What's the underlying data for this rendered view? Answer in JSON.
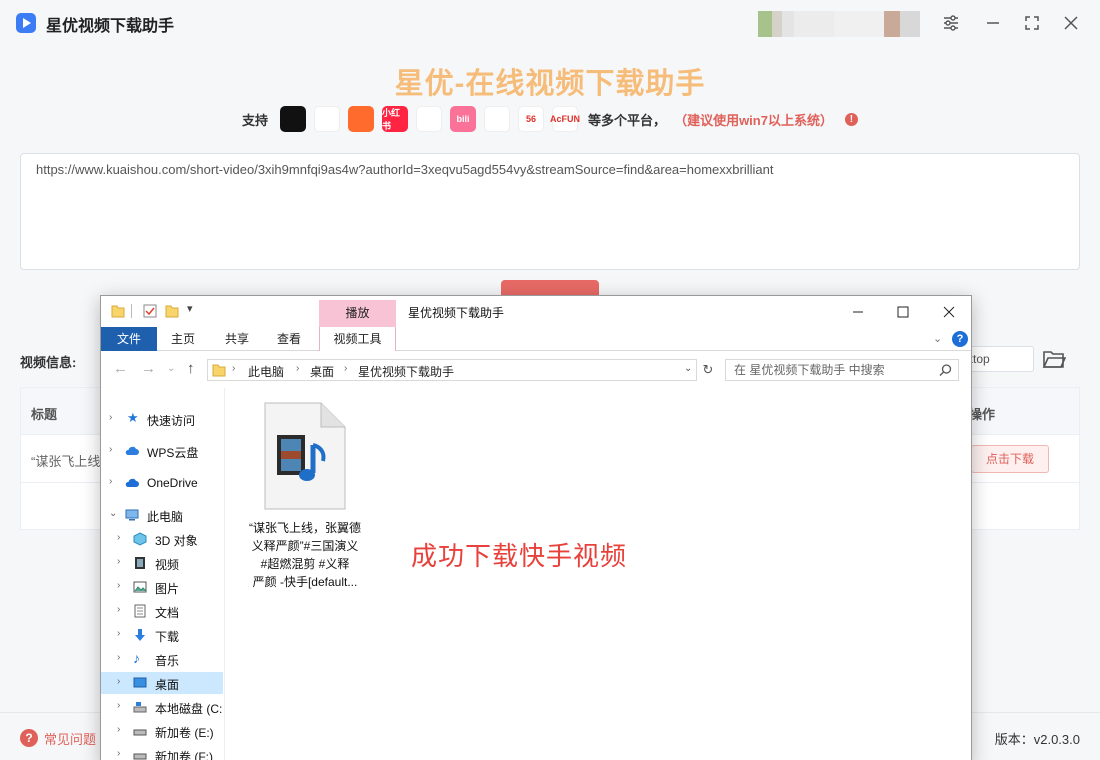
{
  "app": {
    "name": "星优视频下载助手",
    "hero_title": "星优-在线视频下载助手",
    "support_label": "支持",
    "platforms": [
      {
        "name": "douyin-icon",
        "text": "",
        "color": "#111111"
      },
      {
        "name": "weibo-icon",
        "text": "",
        "color": "#ffffff"
      },
      {
        "name": "kuaishou-icon",
        "text": "",
        "color": "#ff6b2c"
      },
      {
        "name": "xiaohongshu-icon",
        "text": "小红书",
        "color": "#ff2442"
      },
      {
        "name": "tencent-video-icon",
        "text": "",
        "color": "#ffffff"
      },
      {
        "name": "bilibili-icon",
        "text": "bili",
        "color": "#fb7299"
      },
      {
        "name": "cctv-icon",
        "text": "",
        "color": "#ffffff"
      },
      {
        "name": "56-icon",
        "text": "56",
        "color": "#ffffff"
      },
      {
        "name": "acfun-icon",
        "text": "AcFUN",
        "color": "#ffffff"
      }
    ],
    "platforms_more": "等多个平台，",
    "system_hint": "（建议使用win7以上系统）",
    "url_value": "https://www.kuaishou.com/short-video/3xih9mnfqi9as4w?authorId=3xeqvu5agd554vy&streamSource=find&area=homexxbrilliant",
    "video_info_label": "视频信息:",
    "save_path_value": "ktop",
    "table": {
      "headers": {
        "title": "标题",
        "action": "操作"
      },
      "row": {
        "title": "“谋张飞上线",
        "action": "点击下载"
      }
    },
    "footer": {
      "faq": "常见问题",
      "version": "版本：v2.0.3.0"
    }
  },
  "explorer": {
    "context_tab": "播放",
    "window_title": "星优视频下载助手",
    "ribbon_tabs": [
      "文件",
      "主页",
      "共享",
      "查看",
      "视频工具"
    ],
    "breadcrumb": [
      "此电脑",
      "桌面",
      "星优视频下载助手"
    ],
    "search_placeholder": "在 星优视频下载助手 中搜索",
    "nav": {
      "quick_access": "快速访问",
      "wps": "WPS云盘",
      "onedrive": "OneDrive",
      "this_pc": "此电脑",
      "objects3d": "3D 对象",
      "videos": "视频",
      "pictures": "图片",
      "documents": "文档",
      "downloads": "下载",
      "music": "音乐",
      "desktop": "桌面",
      "local_disk": "本地磁盘 (C:",
      "vol_e": "新加卷 (E:)",
      "vol_f": "新加卷 (F:)"
    },
    "file_name_lines": [
      "“谋张飞上线，张翼德",
      "义释严颜”#三国演义",
      "#超燃混剪 #义释",
      "严颜 -快手[default..."
    ],
    "annotation": "成功下载快手视频"
  }
}
